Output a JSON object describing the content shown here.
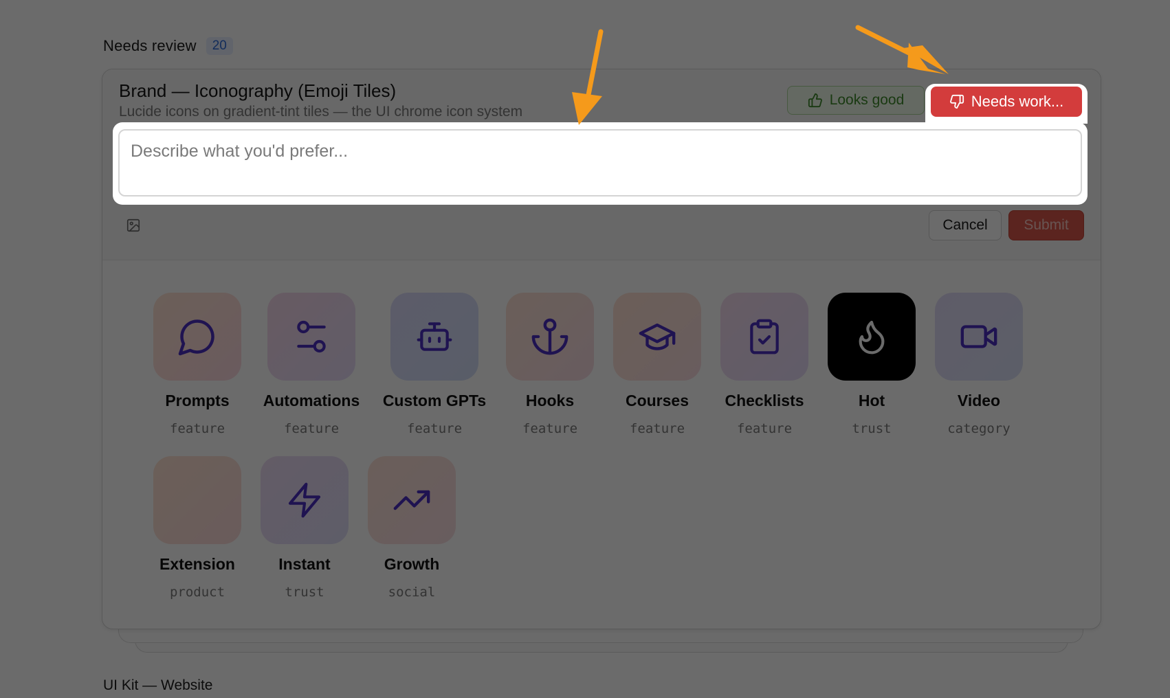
{
  "section": {
    "title": "Needs review",
    "count": "20"
  },
  "card": {
    "title": "Brand — Iconography (Emoji Tiles)",
    "subtitle": "Lucide icons on gradient-tint tiles — the UI chrome icon system"
  },
  "actions": {
    "looks_good": "Looks good",
    "needs_work": "Needs work...",
    "cancel": "Cancel",
    "submit": "Submit"
  },
  "feedback": {
    "placeholder": "Describe what you'd prefer..."
  },
  "tiles": [
    {
      "label": "Prompts",
      "tag": "feature",
      "icon": "message-circle-icon"
    },
    {
      "label": "Automations",
      "tag": "feature",
      "icon": "sliders-icon"
    },
    {
      "label": "Custom GPTs",
      "tag": "feature",
      "icon": "bot-icon"
    },
    {
      "label": "Hooks",
      "tag": "feature",
      "icon": "anchor-icon"
    },
    {
      "label": "Courses",
      "tag": "feature",
      "icon": "graduation-cap-icon"
    },
    {
      "label": "Checklists",
      "tag": "feature",
      "icon": "clipboard-check-icon"
    },
    {
      "label": "Hot",
      "tag": "trust",
      "icon": "flame-icon"
    },
    {
      "label": "Video",
      "tag": "category",
      "icon": "video-icon"
    },
    {
      "label": "Extension",
      "tag": "product",
      "icon": "empty-icon"
    },
    {
      "label": "Instant",
      "tag": "trust",
      "icon": "zap-icon"
    },
    {
      "label": "Growth",
      "tag": "social",
      "icon": "trending-up-icon"
    }
  ],
  "next_section": {
    "title": "UI Kit — Website"
  },
  "colors": {
    "accent_red": "#d33c3c",
    "accent_green": "#3e8a2c",
    "icon_purple": "#5b3fd1",
    "annotation_orange": "#f59a1b"
  }
}
